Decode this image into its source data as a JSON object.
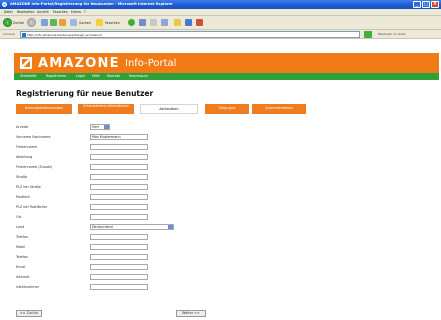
{
  "window": {
    "title": "AMAZONE Info-Portal/Registrierung für Neukunden - Microsoft Internet Explorer"
  },
  "menubar": [
    "Datei",
    "Bearbeiten",
    "Ansicht",
    "Favoriten",
    "Extras",
    "?"
  ],
  "toolbar": {
    "back_label": "Zurück",
    "search_label": "Suchen",
    "favorites_label": "Favoriten"
  },
  "addressbar": {
    "label": "Adresse",
    "url": "http://info.amazone.de/dev.asp?lang0_sv=kassnd",
    "links_label": "Wechseln zu   Links"
  },
  "header": {
    "brand": "AMAZONE",
    "portal": "Info-Portal"
  },
  "nav": [
    "Startseite",
    "Registrieren",
    "Login",
    "Hilfe",
    "Kontakt",
    "Impressum"
  ],
  "page_title": "Registrierung für neue Benutzer",
  "tabs": [
    {
      "label": "Nutzungsbestimmungen",
      "active": false
    },
    {
      "label": "Unternehmens-informationen",
      "active": false
    },
    {
      "label": "Adressdaten",
      "active": true
    },
    {
      "label": "Zielgruppe",
      "active": false
    },
    {
      "label": "Zusammenfassen",
      "active": false
    }
  ],
  "form": {
    "rows": [
      {
        "label": "Anrede",
        "value": "Herr",
        "kind": "small"
      },
      {
        "label": "Vorname Nachname",
        "value": "Max Mustermann",
        "kind": "text"
      },
      {
        "label": "Firmenname",
        "value": "",
        "kind": "text"
      },
      {
        "label": "Abteilung",
        "value": "",
        "kind": "text"
      },
      {
        "label": "Firmenname (Zusatz)",
        "value": "",
        "kind": "text"
      },
      {
        "label": "Straße",
        "value": "",
        "kind": "text"
      },
      {
        "label": "PLZ bei Straße",
        "value": "",
        "kind": "text"
      },
      {
        "label": "Postfach",
        "value": "",
        "kind": "text"
      },
      {
        "label": "PLZ bei Postfächer",
        "value": "",
        "kind": "text"
      },
      {
        "label": "Ort",
        "value": "",
        "kind": "text"
      },
      {
        "label": "Land",
        "value": "Deutschland",
        "kind": "select"
      },
      {
        "label": "Telefon",
        "value": "",
        "kind": "text"
      },
      {
        "label": "Mobil",
        "value": "",
        "kind": "text"
      },
      {
        "label": "Telefax",
        "value": "",
        "kind": "text"
      },
      {
        "label": "Email",
        "value": "",
        "kind": "text"
      },
      {
        "label": "Internet",
        "value": "",
        "kind": "text"
      },
      {
        "label": "Ustldnummer",
        "value": "",
        "kind": "text"
      }
    ]
  },
  "buttons": {
    "back": "<< Zurück",
    "next": "Weiter >>"
  },
  "colors": {
    "accent_orange": "#f07b17",
    "nav_green": "#2fa03a",
    "titlebar_blue": "#1e5ad0"
  }
}
